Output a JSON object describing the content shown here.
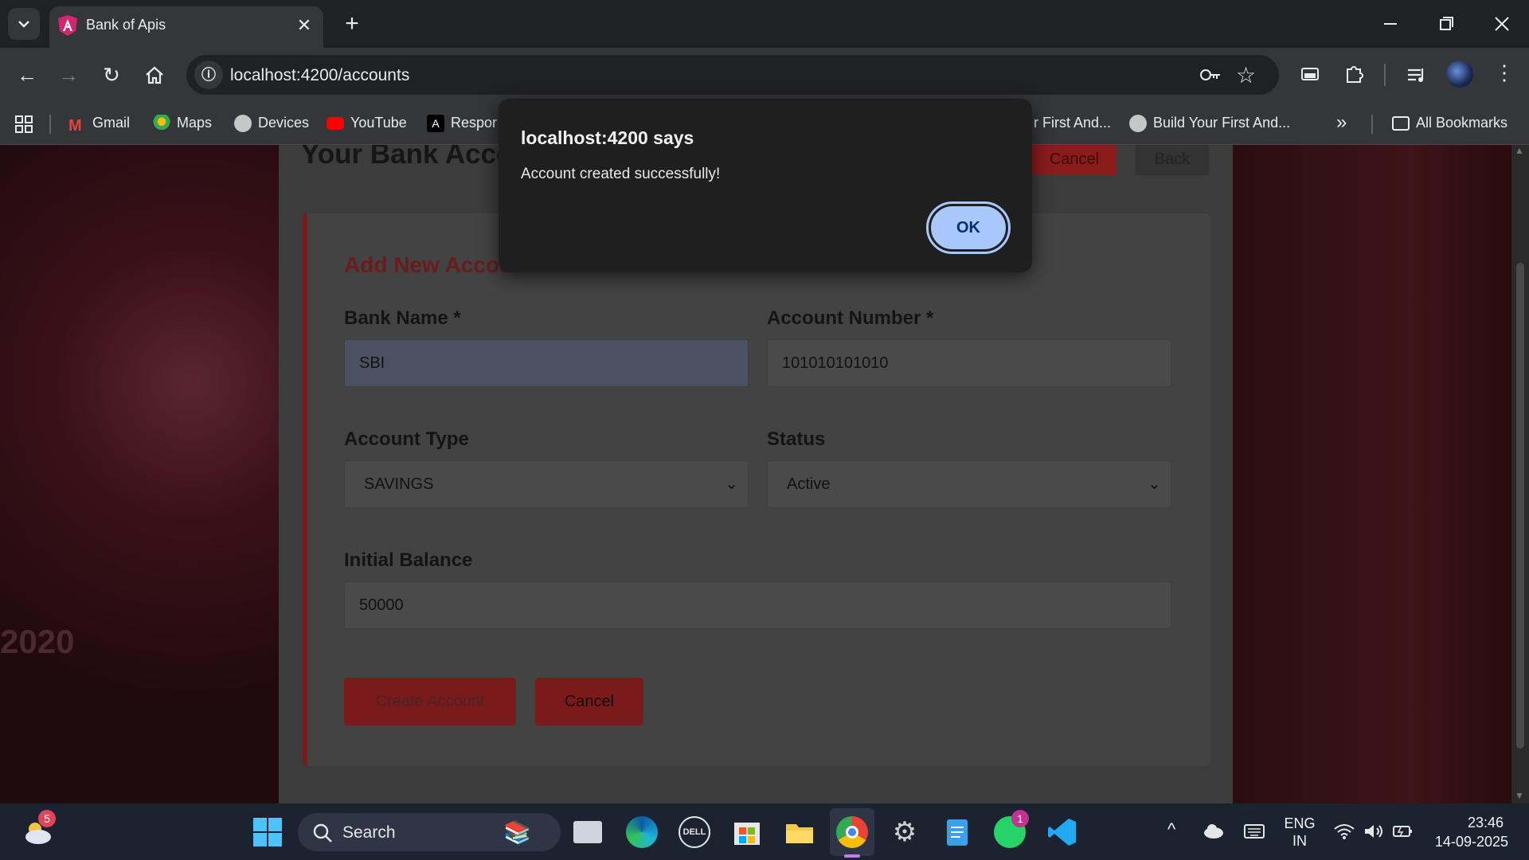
{
  "browser": {
    "tab_title": "Bank of Apis",
    "url": "localhost:4200/accounts",
    "bookmarks": [
      {
        "label": "Gmail",
        "icon": "gmail-icon"
      },
      {
        "label": "Maps",
        "icon": "maps-icon"
      },
      {
        "label": "Devices",
        "icon": "globe-icon"
      },
      {
        "label": "YouTube",
        "icon": "youtube-icon"
      },
      {
        "label": "Respor",
        "icon": "angular-icon"
      },
      {
        "label": "r First And...",
        "icon": ""
      },
      {
        "label": "Build Your First And...",
        "icon": "globe-icon"
      }
    ],
    "all_bookmarks": "All Bookmarks"
  },
  "page": {
    "heading": "Your Bank Acco",
    "top_cancel": "Cancel",
    "top_back": "Back",
    "form_title": "Add New Accou",
    "bank_name_label": "Bank Name *",
    "bank_name_value": "SBI",
    "account_number_label": "Account Number *",
    "account_number_value": "101010101010",
    "account_type_label": "Account Type",
    "account_type_value": "SAVINGS",
    "status_label": "Status",
    "status_value": "Active",
    "initial_balance_label": "Initial Balance",
    "initial_balance_value": "50000",
    "create_button": "Create Account",
    "cancel_button": "Cancel",
    "bg_text": "2020"
  },
  "dialog": {
    "title": "localhost:4200 says",
    "message": "Account created successfully!",
    "ok": "OK"
  },
  "taskbar": {
    "search": "Search",
    "weather_badge": "5",
    "whatsapp_badge": "1",
    "lang_line1": "ENG",
    "lang_line2": "IN",
    "time": "23:46",
    "date": "14-09-2025"
  },
  "colors": {
    "accent": "#a8c7fa",
    "brand_red": "#8a1c1c"
  }
}
